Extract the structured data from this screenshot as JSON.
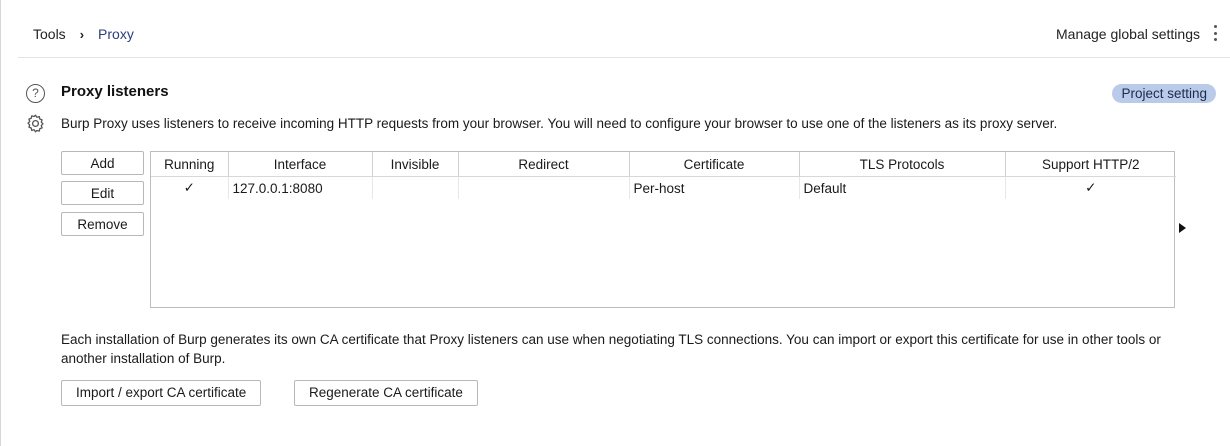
{
  "breadcrumb": {
    "root": "Tools",
    "separator": "›",
    "current": "Proxy"
  },
  "header": {
    "manage_label": "Manage global settings"
  },
  "section": {
    "title": "Proxy listeners",
    "badge": "Project setting",
    "description": "Burp Proxy uses listeners to receive incoming HTTP requests from your browser. You will need to configure your browser to use one of the listeners as its proxy server."
  },
  "buttons": {
    "add": "Add",
    "edit": "Edit",
    "remove": "Remove"
  },
  "table": {
    "columns": [
      "Running",
      "Interface",
      "Invisible",
      "Redirect",
      "Certificate",
      "TLS Protocols",
      "Support HTTP/2"
    ],
    "rows": [
      {
        "running": "✓",
        "interface": "127.0.0.1:8080",
        "invisible": "",
        "redirect": "",
        "certificate": "Per-host",
        "tls": "Default",
        "http2": "✓"
      }
    ]
  },
  "ca": {
    "description": "Each installation of Burp generates its own CA certificate that Proxy listeners can use when negotiating TLS connections. You can import or export this certificate for use in other tools or another installation of Burp.",
    "import_label": "Import / export CA certificate",
    "regen_label": "Regenerate CA certificate"
  },
  "colors": {
    "badge_bg": "#b9cbe8",
    "breadcrumb_current": "#2d3d7a"
  },
  "icons": {
    "help": "help-circle-icon",
    "settings": "gear-icon",
    "menu": "kebab-menu-icon",
    "scroll": "scroll-right-icon"
  }
}
